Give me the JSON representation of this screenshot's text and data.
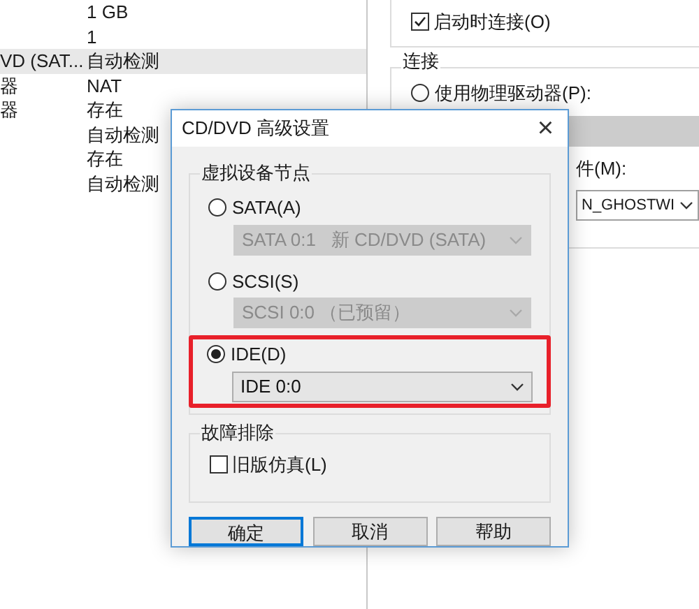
{
  "details_list": {
    "rows": [
      {
        "value": "1 GB",
        "selected": false
      },
      {
        "value": "1",
        "selected": false
      },
      {
        "label": "VD (SAT...",
        "value": "自动检测",
        "selected": true
      },
      {
        "label": "器",
        "value": "NAT",
        "selected": false
      },
      {
        "label": "器",
        "value": "存在",
        "selected": false
      },
      {
        "value": "自动检测",
        "selected": false
      },
      {
        "value": "存在",
        "selected": false
      },
      {
        "value": "自动检测",
        "selected": false
      }
    ]
  },
  "right_panel": {
    "startup_checkbox": {
      "label": "启动时连接(O)",
      "checked": true
    },
    "connection": {
      "title": "连接",
      "physical_radio": {
        "label": "使用物理驱动器(P):",
        "selected": false
      },
      "iso_label": "件(M):",
      "iso_path": "N_GHOSTWI"
    }
  },
  "dialog": {
    "title": "CD/DVD 高级设置",
    "close": "×",
    "node_group": {
      "title": "虚拟设备节点",
      "options": [
        {
          "label": "SATA(A)",
          "selected": false,
          "highlighted": false,
          "select_value": "SATA 0:1   新 CD/DVD (SATA)"
        },
        {
          "label": "SCSI(S)",
          "selected": false,
          "highlighted": false,
          "select_value": "SCSI 0:0 （已预留）"
        },
        {
          "label": "IDE(D)",
          "selected": true,
          "highlighted": true,
          "select_value": "IDE 0:0"
        }
      ]
    },
    "troubleshoot_group": {
      "title": "故障排除",
      "legacy_checkbox": {
        "label": "旧版仿真(L)",
        "checked": false
      }
    },
    "buttons": [
      {
        "label": "确定",
        "focused": true
      },
      {
        "label": "取消",
        "focused": false
      },
      {
        "label": "帮助",
        "focused": false
      }
    ]
  }
}
